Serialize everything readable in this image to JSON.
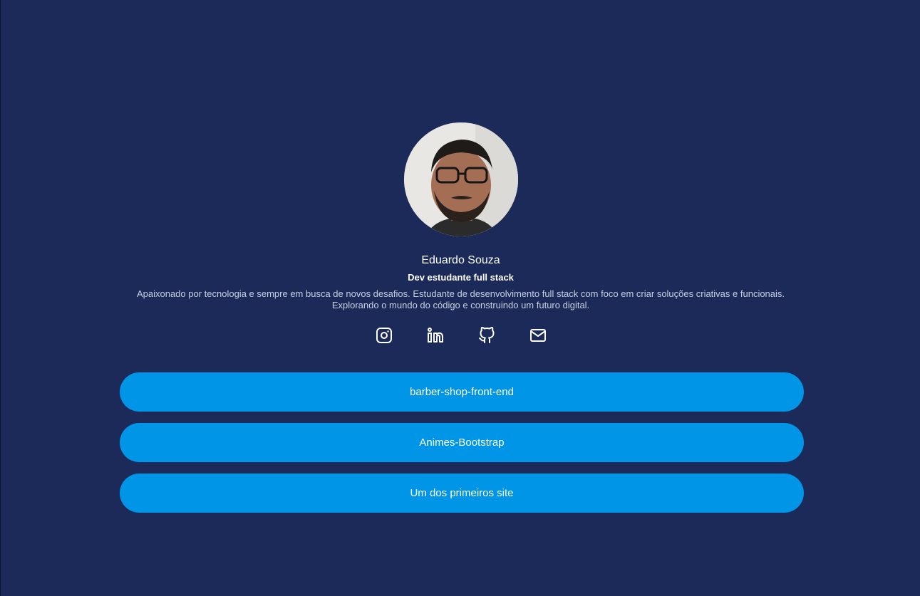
{
  "profile": {
    "name": "Eduardo Souza",
    "role": "Dev estudante full stack",
    "bio": "Apaixonado por tecnologia e sempre em busca de novos desafios. Estudante de desenvolvimento full stack com foco em criar soluções criativas e funcionais. Explorando o mundo do código e construindo um futuro digital."
  },
  "socials": [
    {
      "icon": "instagram-icon"
    },
    {
      "icon": "linkedin-icon"
    },
    {
      "icon": "github-icon"
    },
    {
      "icon": "mail-icon"
    }
  ],
  "links": [
    {
      "label": "barber-shop-front-end"
    },
    {
      "label": "Animes-Bootstrap"
    },
    {
      "label": "Um dos primeiros site"
    }
  ],
  "colors": {
    "background": "#1b2a58",
    "button": "#0095e6",
    "text": "#ffffff"
  }
}
